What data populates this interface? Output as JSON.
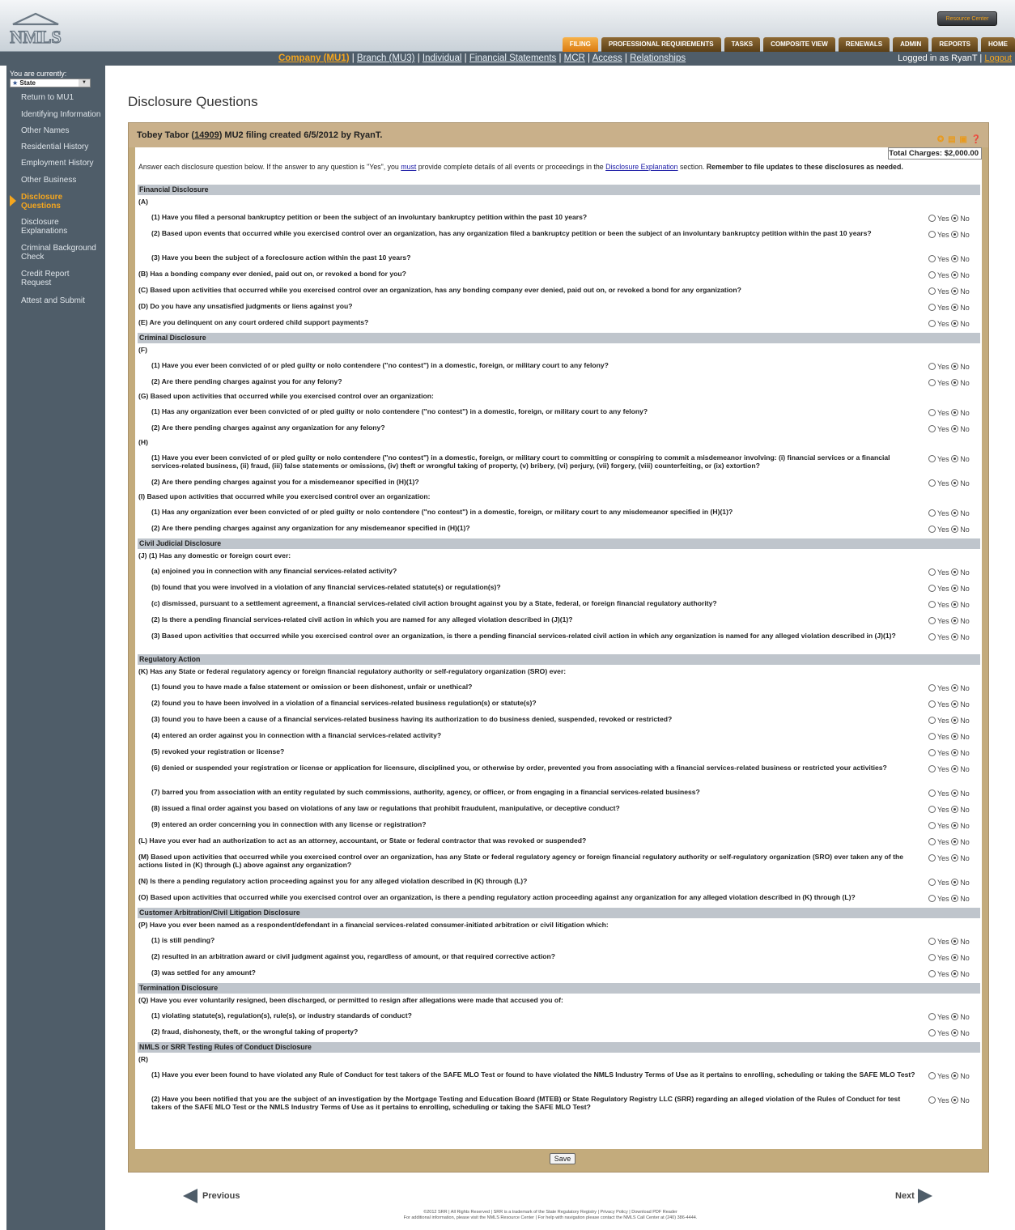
{
  "header": {
    "resource_center": "Resource Center",
    "tabs": [
      "FILING",
      "PROFESSIONAL REQUIREMENTS",
      "TASKS",
      "COMPOSITE VIEW",
      "RENEWALS",
      "ADMIN",
      "REPORTS",
      "HOME"
    ]
  },
  "subnav": {
    "links": [
      "Company (MU1)",
      "Branch (MU3)",
      "Individual",
      "Financial Statements",
      "MCR",
      "Access",
      "Relationships"
    ],
    "logged_in": "Logged in as RyanT",
    "logout": "Logout"
  },
  "sidebar": {
    "you_are": "You are currently:",
    "state": "State",
    "items": [
      "Return to MU1",
      "Identifying Information",
      "Other Names",
      "Residential History",
      "Employment History",
      "Other Business",
      "Disclosure Questions",
      "Disclosure Explanations",
      "Criminal Background Check",
      "Credit Report Request",
      "Attest and Submit"
    ]
  },
  "page_title": "Disclosure Questions",
  "form": {
    "head_pre": "Tobey Tabor (",
    "head_id": "14909",
    "head_post": ") MU2 filing created 6/5/2012 by RyanT.",
    "total_charges": "Total Charges: $2,000.00",
    "instr_a": "Answer each disclosure question below. If the answer to any question is \"Yes\", you ",
    "instr_must": "must",
    "instr_b": " provide complete details of all events or proceedings in the ",
    "instr_link": "Disclosure Explanation",
    "instr_c": " section. ",
    "instr_bold": "Remember to file updates to these disclosures as needed.",
    "yes": "Yes",
    "no": "No",
    "save": "Save"
  },
  "rows": [
    [
      "s",
      "Financial Disclosure"
    ],
    [
      "t",
      "(A)"
    ],
    [
      "q",
      "(1) Have you filed a personal bankruptcy petition or been the subject of an involuntary bankruptcy petition within the past 10 years?"
    ],
    [
      "q",
      "(2) Based upon events that occurred while you exercised control over an organization, has any organization filed a bankruptcy petition or been the subject of an involuntary bankruptcy petition within the past 10 years?"
    ],
    [
      "q",
      "(3) Have you been the subject of a foreclosure action within the past 10 years?"
    ],
    [
      "Q",
      "(B) Has a bonding company ever denied, paid out on, or revoked a bond for you?"
    ],
    [
      "Q",
      "(C) Based upon activities that occurred while you exercised control over an organization, has any bonding company ever denied, paid out on, or revoked a bond for any organization?"
    ],
    [
      "Q",
      "(D) Do you have any unsatisfied judgments or liens against you?"
    ],
    [
      "Q",
      "(E) Are you delinquent on any court ordered child support payments?"
    ],
    [
      "s",
      "Criminal Disclosure"
    ],
    [
      "t",
      "(F)"
    ],
    [
      "q",
      "(1) Have you ever been convicted of or pled guilty or nolo contendere (\"no contest\") in a domestic, foreign, or military court to any felony?"
    ],
    [
      "q",
      "(2) Are there pending charges against you for any felony?"
    ],
    [
      "t",
      "(G) Based upon activities that occurred while you exercised control over an organization:"
    ],
    [
      "q",
      "(1) Has any organization ever been convicted of or pled guilty or nolo contendere (\"no contest\") in a domestic, foreign, or military court to any felony?"
    ],
    [
      "q",
      "(2) Are there pending charges against any organization for any felony?"
    ],
    [
      "t",
      "(H)"
    ],
    [
      "q",
      "(1) Have you ever been convicted of or pled guilty or nolo contendere (\"no contest\") in a domestic, foreign, or military court to committing or conspiring to commit a misdemeanor involving: (i) financial services or a financial services-related business, (ii) fraud, (iii) false statements or omissions, (iv) theft or wrongful taking of property, (v) bribery, (vi) perjury, (vii) forgery, (viii) counterfeiting, or (ix) extortion?"
    ],
    [
      "q",
      "(2) Are there pending charges against you for a misdemeanor specified in (H)(1)?"
    ],
    [
      "t",
      "(I) Based upon activities that occurred while you exercised control over an organization:"
    ],
    [
      "q",
      "(1) Has any organization ever been convicted of or pled guilty or nolo contendere (\"no contest\") in a domestic, foreign, or military court to any misdemeanor specified in (H)(1)?"
    ],
    [
      "q",
      "(2) Are there pending charges against any organization for any misdemeanor specified in (H)(1)?"
    ],
    [
      "s",
      "Civil Judicial Disclosure"
    ],
    [
      "t",
      "(J) (1) Has any domestic or foreign court ever:"
    ],
    [
      "q",
      "(a) enjoined you in connection with any financial services-related activity?"
    ],
    [
      "q",
      "(b) found that you were involved in a violation of any financial services-related statute(s) or regulation(s)?"
    ],
    [
      "q",
      "(c) dismissed, pursuant to a settlement agreement, a financial services-related civil action brought against you by a State, federal, or foreign financial regulatory authority?"
    ],
    [
      "q",
      "(2) Is there a pending financial services-related civil action in which you are named for any alleged violation described in (J)(1)?"
    ],
    [
      "q",
      "(3) Based upon activities that occurred while you exercised control over an organization, is there a pending financial services-related civil action in which any organization is named for any alleged violation described in (J)(1)?"
    ],
    [
      "s",
      "Regulatory Action"
    ],
    [
      "t",
      "(K) Has any State or federal regulatory agency or foreign financial regulatory authority or self-regulatory organization (SRO) ever:"
    ],
    [
      "q",
      "(1) found you to have made a false statement or omission or been dishonest, unfair or unethical?"
    ],
    [
      "q",
      "(2) found you to have been involved in a violation of a financial services-related business regulation(s) or statute(s)?"
    ],
    [
      "q",
      "(3) found you to have been a cause of a financial services-related business having its authorization to do business denied, suspended, revoked or restricted?"
    ],
    [
      "q",
      "(4) entered an order against you in connection with a financial services-related activity?"
    ],
    [
      "q",
      "(5) revoked your registration or license?"
    ],
    [
      "q",
      "(6) denied or suspended your registration or license or application for licensure, disciplined you, or otherwise by order, prevented you from associating with a financial services-related business or restricted your activities?"
    ],
    [
      "q",
      "(7) barred you from association with an entity regulated by such commissions, authority, agency, or officer, or from engaging in a financial services-related business?"
    ],
    [
      "q",
      "(8) issued a final order against you based on violations of any law or regulations that prohibit fraudulent, manipulative, or deceptive conduct?"
    ],
    [
      "q",
      "(9) entered an order concerning you in connection with any license or registration?"
    ],
    [
      "Q",
      "(L) Have you ever had an authorization to act as an attorney, accountant, or State or federal contractor that was revoked or suspended?"
    ],
    [
      "Q",
      "(M) Based upon activities that occurred while you exercised control over an organization, has any State or federal regulatory agency or foreign financial regulatory authority or self-regulatory organization (SRO) ever taken any of the actions listed in (K) through (L) above against any organization?"
    ],
    [
      "Q",
      "(N) Is there a pending regulatory action proceeding against you for any alleged violation described in (K) through (L)?"
    ],
    [
      "Q",
      "(O) Based upon activities that occurred while you exercised control over an organization, is there a pending regulatory action proceeding against any organization for any alleged violation described in (K) through (L)?"
    ],
    [
      "s",
      "Customer Arbitration/Civil Litigation Disclosure"
    ],
    [
      "t",
      "(P) Have you ever been named as a respondent/defendant in a financial services-related consumer-initiated arbitration or civil litigation which:"
    ],
    [
      "q",
      "(1) is still pending?"
    ],
    [
      "q",
      "(2) resulted in an arbitration award or civil judgment against you, regardless of amount, or that required corrective action?"
    ],
    [
      "q",
      "(3) was settled for any amount?"
    ],
    [
      "s",
      "Termination Disclosure"
    ],
    [
      "t",
      "(Q) Have you ever voluntarily resigned, been discharged, or permitted to resign after allegations were made that accused you of:"
    ],
    [
      "q",
      "(1) violating statute(s), regulation(s), rule(s), or industry standards of conduct?"
    ],
    [
      "q",
      "(2) fraud, dishonesty, theft, or the wrongful taking of property?"
    ],
    [
      "s",
      "NMLS or SRR Testing Rules of Conduct Disclosure"
    ],
    [
      "t",
      "(R)"
    ],
    [
      "q",
      "(1) Have you ever been found to have violated any Rule of Conduct for test takers of the SAFE MLO Test or found to have violated the NMLS Industry Terms of Use as it pertains to enrolling, scheduling or taking the SAFE MLO Test?"
    ],
    [
      "q",
      "(2) Have you been notified that you are the subject of an investigation by the Mortgage Testing and Education Board (MTEB) or State Regulatory Registry LLC (SRR) regarding an alleged violation of the Rules of Conduct for test takers of the SAFE MLO Test or the NMLS Industry Terms of Use as it pertains to enrolling, scheduling or taking the SAFE MLO Test?"
    ]
  ],
  "pager": {
    "previous": "Previous",
    "next": "Next"
  },
  "footer": {
    "line1": "©2012 SRR | All Rights Reserved | SRR is a trademark of the State Regulatory Registry | Privacy Policy | Download PDF Reader",
    "line2": "For additional information, please visit the NMLS Resource Center | For help with navigation please contact the NMLS Call Center at (240) 386-4444."
  }
}
